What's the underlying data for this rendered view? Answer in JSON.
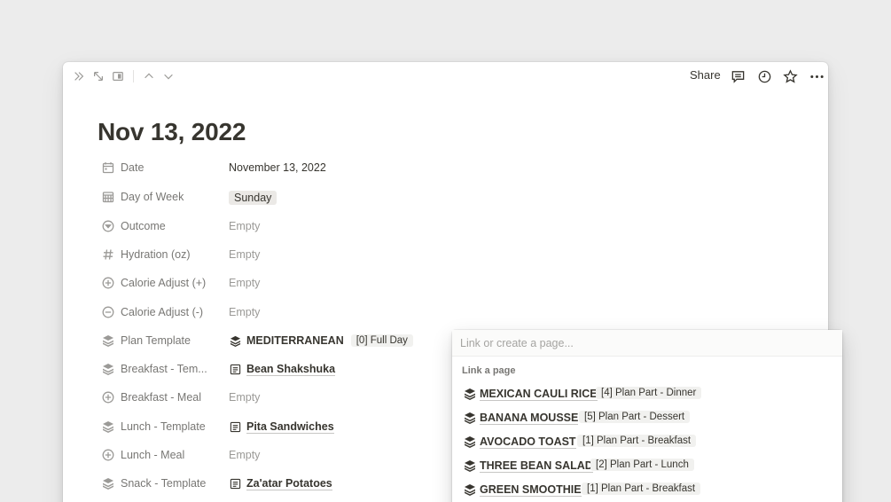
{
  "topbar": {
    "share_label": "Share"
  },
  "page": {
    "title": "Nov 13, 2022"
  },
  "properties": [
    {
      "label": "Date",
      "icon": "calendar-icon",
      "value": "November 13, 2022"
    },
    {
      "label": "Day of Week",
      "icon": "calendar-grid-icon",
      "value": "Sunday"
    },
    {
      "label": "Outcome",
      "icon": "select-circle-icon",
      "value": "Empty"
    },
    {
      "label": "Hydration (oz)",
      "icon": "hash-icon",
      "value": "Empty"
    },
    {
      "label": "Calorie Adjust (+)",
      "icon": "plus-circle-icon",
      "value": "Empty"
    },
    {
      "label": "Calorie Adjust (-)",
      "icon": "minus-circle-icon",
      "value": "Empty"
    },
    {
      "label": "Plan Template",
      "icon": "stack-icon",
      "value": "MEDITERRANEAN",
      "tag": "[0] Full Day"
    },
    {
      "label": "Breakfast - Tem...",
      "icon": "stack-icon",
      "value": "Bean Shakshuka"
    },
    {
      "label": "Breakfast - Meal",
      "icon": "plus-circle-icon",
      "value": "Empty"
    },
    {
      "label": "Lunch - Template",
      "icon": "stack-icon",
      "value": "Pita Sandwiches"
    },
    {
      "label": "Lunch - Meal",
      "icon": "plus-circle-icon",
      "value": "Empty"
    },
    {
      "label": "Snack - Template",
      "icon": "stack-icon",
      "value": "Za'atar Potatoes"
    }
  ],
  "dropdown": {
    "placeholder": "Link or create a page...",
    "heading": "Link a page",
    "items": [
      {
        "name": "MEXICAN CAULI RICE",
        "plan": "[4] Plan Part - Dinner"
      },
      {
        "name": "BANANA MOUSSE",
        "plan": "[5] Plan Part - Dessert"
      },
      {
        "name": "AVOCADO TOAST",
        "plan": "[1] Plan Part - Breakfast"
      },
      {
        "name": "THREE BEAN SALAD",
        "plan": "[2] Plan Part - Lunch"
      },
      {
        "name": "GREEN SMOOTHIE",
        "plan": "[1] Plan Part - Breakfast"
      }
    ]
  }
}
